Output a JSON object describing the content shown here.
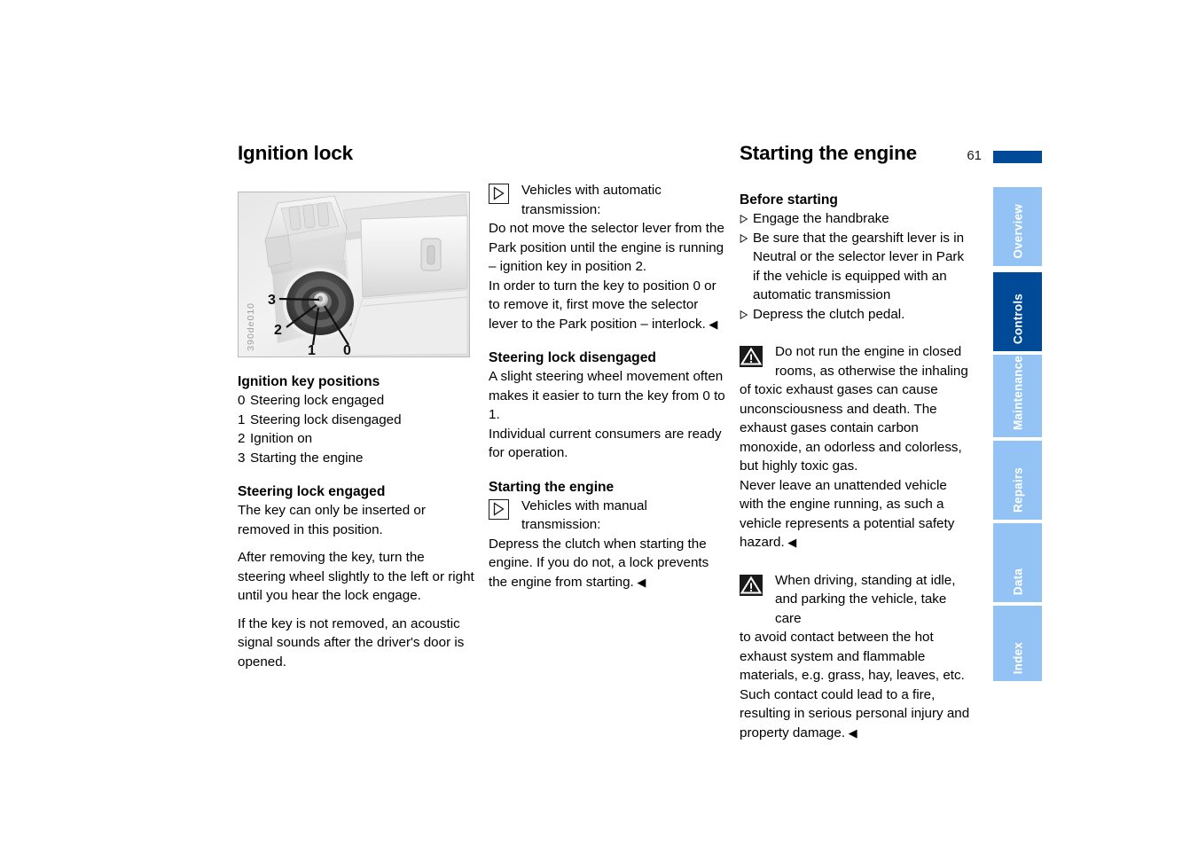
{
  "page": {
    "number": "61",
    "accent_color": "#004a98",
    "tab_color": "#93c3f5"
  },
  "left_column": {
    "title": "Ignition lock",
    "figure": {
      "code": "390de010",
      "callouts": [
        "3",
        "2",
        "1",
        "0"
      ],
      "alt": "Dashboard ignition lock with key positions 0 to 3"
    },
    "key_positions_heading": "Ignition key positions",
    "key_positions": [
      {
        "num": "0",
        "text": "Steering lock engaged"
      },
      {
        "num": "1",
        "text": "Steering lock disengaged"
      },
      {
        "num": "2",
        "text": "Ignition on"
      },
      {
        "num": "3",
        "text": "Starting the engine"
      }
    ],
    "steering_lock_heading": "Steering lock engaged",
    "steering_lock_p1": "The key can only be inserted or removed in this position.",
    "steering_lock_p2": "After removing the key, turn the steering wheel slightly to the left or right until you hear the lock engage.",
    "steering_lock_p3": "If the key is not removed, an acoustic signal sounds after the driver's door is opened."
  },
  "middle_column": {
    "auto_note_lead": "Vehicles with automatic transmission:",
    "auto_note_body": "Do not move the selector lever from the Park position until the engine is running – ignition key in position 2.\nIn order to turn the key to position 0 or to remove it, first move the selector lever to the Park position – interlock.",
    "steering_disengaged_heading": "Steering lock disengaged",
    "steering_disengaged_body": "A slight steering wheel movement often makes it easier to turn the key from 0 to 1.\nIndividual current consumers are ready for operation.",
    "starting_heading": "Starting the engine",
    "manual_note_lead": "Vehicles with manual transmission:",
    "manual_note_body": "Depress the clutch when starting the engine. If you do not, a lock prevents the engine from starting.",
    "end_mark": "◀"
  },
  "right_column": {
    "title": "Starting the engine",
    "before_starting_heading": "Before starting",
    "before_starting_items": [
      "Engage the handbrake",
      "Be sure that the gearshift lever is in Neutral or the selector lever in Park if the vehicle is equipped with an automatic transmission",
      "Depress the clutch pedal."
    ],
    "warning_1_lead": "Do not run the engine in closed rooms, as otherwise the inhaling",
    "warning_1_body": "of toxic exhaust gases can cause unconsciousness and death. The exhaust gases contain carbon monoxide, an odorless and colorless, but highly toxic gas.\nNever leave an unattended vehicle with the engine running, as such a vehicle represents a potential safety hazard.",
    "warning_2_lead": "When driving, standing at idle, and parking the vehicle, take care",
    "warning_2_body": "to avoid contact between the hot exhaust system and flammable materials, e.g. grass, hay, leaves, etc. Such contact could lead to a fire, resulting in serious personal injury and property damage.",
    "end_mark": "◀"
  },
  "sidebar": {
    "tabs": [
      {
        "label": "Overview",
        "active": false
      },
      {
        "label": "Controls",
        "active": true
      },
      {
        "label": "Maintenance",
        "active": false
      },
      {
        "label": "Repairs",
        "active": false
      },
      {
        "label": "Data",
        "active": false
      },
      {
        "label": "Index",
        "active": false
      }
    ]
  }
}
